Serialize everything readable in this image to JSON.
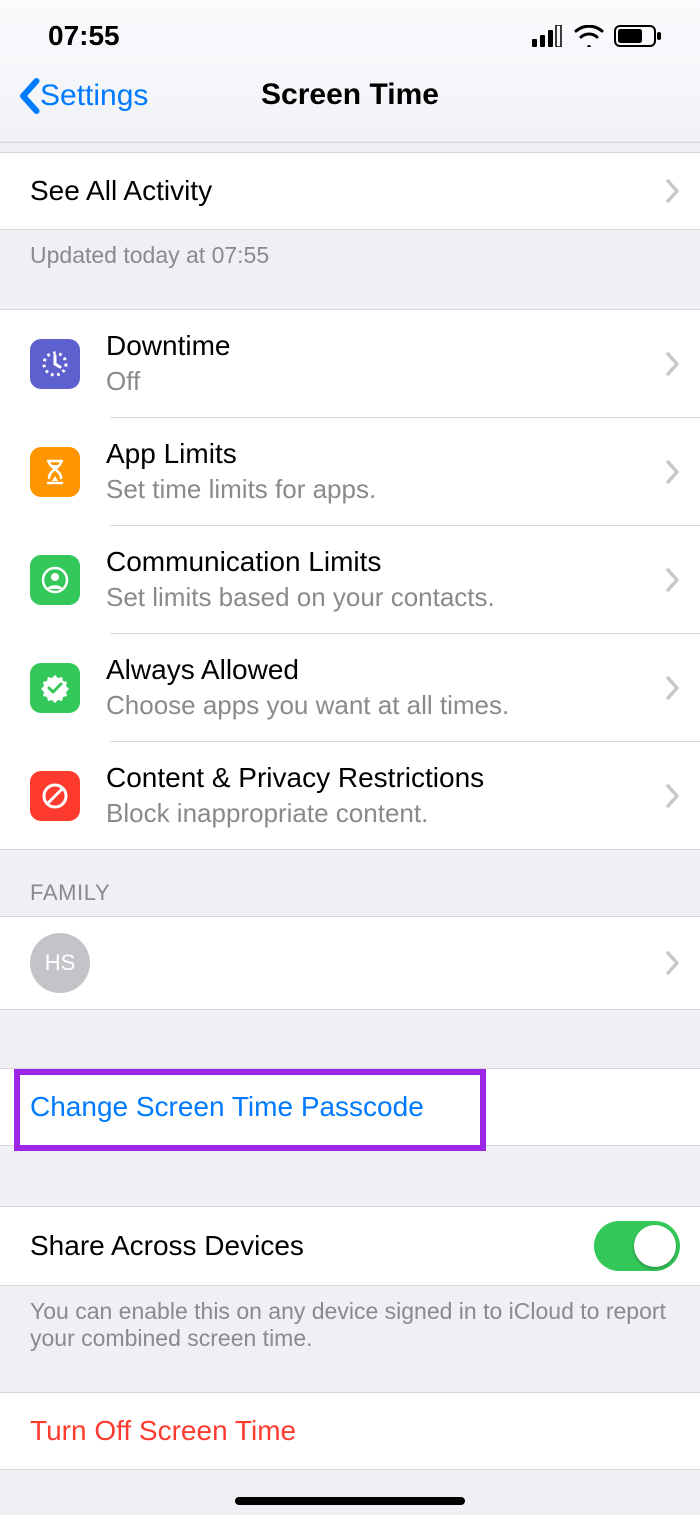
{
  "statusbar": {
    "time": "07:55"
  },
  "nav": {
    "back": "Settings",
    "title": "Screen Time"
  },
  "activity": {
    "see_all": "See All Activity",
    "updated": "Updated today at 07:55"
  },
  "features": [
    {
      "icon_bg": "#5e60ce",
      "title": "Downtime",
      "sub": "Off"
    },
    {
      "icon_bg": "#ff9500",
      "title": "App Limits",
      "sub": "Set time limits for apps."
    },
    {
      "icon_bg": "#34c759",
      "title": "Communication Limits",
      "sub": "Set limits based on your contacts."
    },
    {
      "icon_bg": "#34c759",
      "title": "Always Allowed",
      "sub": "Choose apps you want at all times."
    },
    {
      "icon_bg": "#ff3b30",
      "title": "Content & Privacy Restrictions",
      "sub": "Block inappropriate content."
    }
  ],
  "family": {
    "header": "FAMILY",
    "members": [
      {
        "initials": "HS"
      }
    ]
  },
  "passcode": {
    "change": "Change Screen Time Passcode"
  },
  "share": {
    "title": "Share Across Devices",
    "on": true,
    "footer": "You can enable this on any device signed in to iCloud to report your combined screen time."
  },
  "turn_off": "Turn Off Screen Time"
}
